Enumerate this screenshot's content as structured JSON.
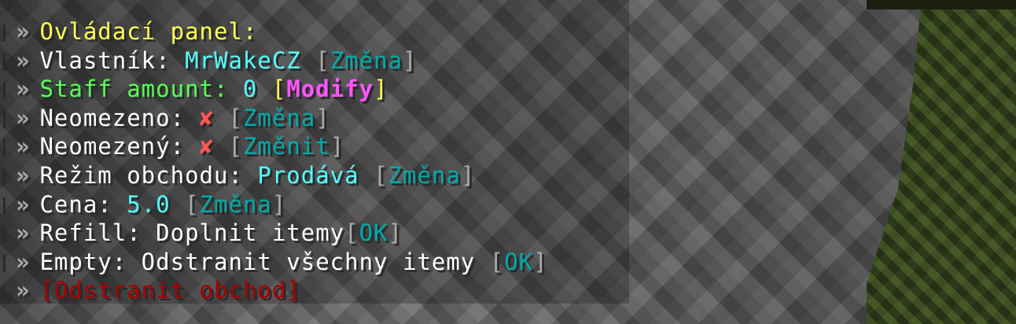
{
  "prefix": "»",
  "lines": {
    "title": "Ovládací panel:",
    "owner": {
      "label": "Vlastník:",
      "value": "MrWakeCZ",
      "bracket_open": "[",
      "action": "Změna",
      "bracket_close": "]"
    },
    "staff": {
      "label": "Staff amount:",
      "value": "0",
      "bracket_open": "[",
      "action": "Modify",
      "bracket_close": "]"
    },
    "unlimited1": {
      "label": "Neomezeno:",
      "value": "✘",
      "bracket_open": "[",
      "action": "Změna",
      "bracket_close": "]"
    },
    "unlimited2": {
      "label": "Neomezený:",
      "value": "✘",
      "bracket_open": "[",
      "action": "Změnit",
      "bracket_close": "]"
    },
    "mode": {
      "label": "Režim obchodu:",
      "value": "Prodává",
      "bracket_open": "[",
      "action": "Změna",
      "bracket_close": "]"
    },
    "price": {
      "label": "Cena:",
      "value": "5.0",
      "bracket_open": "[",
      "action": "Změna",
      "bracket_close": "]"
    },
    "refill": {
      "label": "Refill: Doplnit itemy",
      "bracket_open": "[",
      "action": "OK",
      "bracket_close": "]"
    },
    "empty": {
      "label": "Empty: Odstranit všechny itemy",
      "bracket_open": "[",
      "action": "OK",
      "bracket_close": "]"
    },
    "remove": {
      "action": "[Odstranit obchod]"
    }
  },
  "colors": {
    "yellow": "#ffff55",
    "aqua": "#55ffff",
    "green": "#55ff55",
    "dark_aqua": "#00aaaa",
    "pink": "#ff55ff",
    "red": "#ff5555",
    "gray": "#aaaaaa",
    "dark_red": "#aa0000"
  }
}
